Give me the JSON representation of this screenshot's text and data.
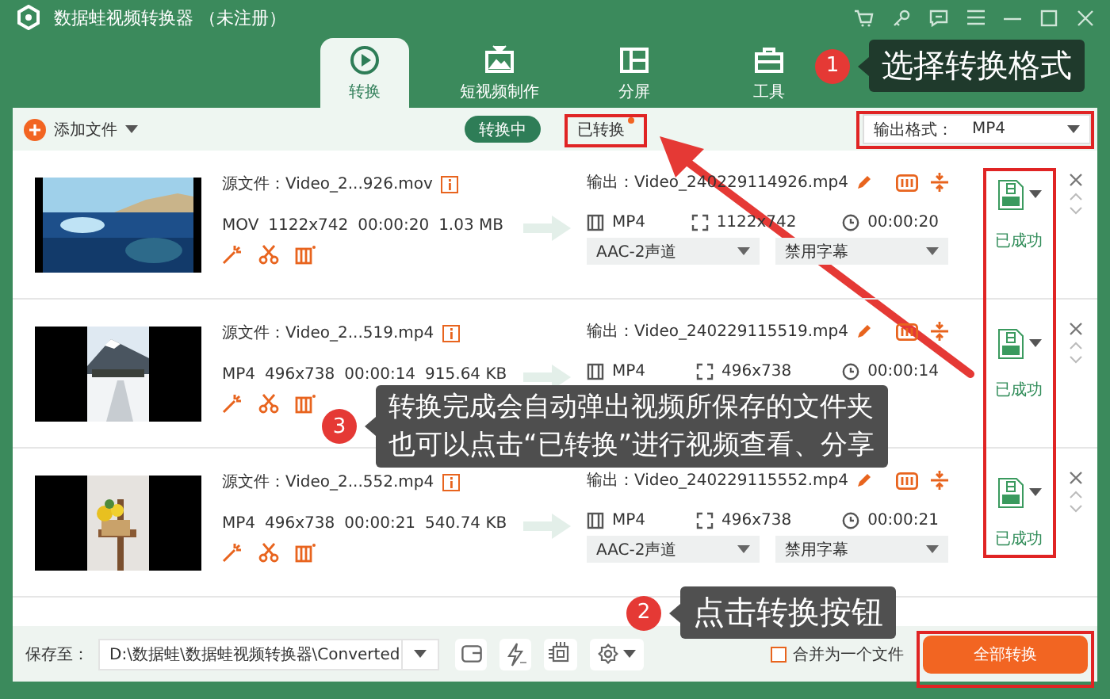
{
  "window": {
    "title": "数据蛙视频转换器 （未注册）"
  },
  "tabs": [
    {
      "label": "转换",
      "selected": true
    },
    {
      "label": "短视频制作",
      "selected": false
    },
    {
      "label": "分屏",
      "selected": false
    },
    {
      "label": "工具",
      "selected": false
    }
  ],
  "toolbar": {
    "add_file": "添加文件",
    "views": [
      {
        "label": "转换中",
        "selected": true,
        "badge_dot": false
      },
      {
        "label": "已转换",
        "selected": false,
        "badge_dot": true
      }
    ],
    "output_format": {
      "label": "输出格式：",
      "value": "MP4"
    }
  },
  "files": [
    {
      "source": "源文件：Video_2...926.mov",
      "format": "MOV",
      "resolution": "1122x742",
      "duration": "00:00:20",
      "size": "1.03 MB",
      "output": "输出：Video_240229114926.mp4",
      "out_format": "MP4",
      "out_resolution": "1122x742",
      "out_duration": "00:00:20",
      "audio": "AAC-2声道",
      "subtitle": "禁用字幕",
      "status": "已成功"
    },
    {
      "source": "源文件：Video_2...519.mp4",
      "format": "MP4",
      "resolution": "496x738",
      "duration": "00:00:14",
      "size": "915.64 KB",
      "output": "输出：Video_240229115519.mp4",
      "out_format": "MP4",
      "out_resolution": "496x738",
      "out_duration": "00:00:14",
      "status": "已成功"
    },
    {
      "source": "源文件：Video_2...552.mp4",
      "format": "MP4",
      "resolution": "496x738",
      "duration": "00:00:21",
      "size": "540.74 KB",
      "output": "输出：Video_240229115552.mp4",
      "out_format": "MP4",
      "out_resolution": "496x738",
      "out_duration": "00:00:21",
      "audio": "AAC-2声道",
      "subtitle": "禁用字幕",
      "status": "已成功"
    }
  ],
  "bottom_bar": {
    "save_label": "保存至：",
    "path": "D:\\数据蛙\\数据蛙视频转换器\\Converted",
    "merge": {
      "label": "合并为一个文件",
      "checked": false
    },
    "convert_all": "全部转换"
  },
  "callouts": [
    {
      "number": "1",
      "lines": [
        "选择转换格式"
      ]
    },
    {
      "number": "3",
      "lines": [
        "转换完成会自动弹出视频所保存的文件夹",
        "也可以点击“已转换”进行视频查看、分享"
      ]
    },
    {
      "number": "2",
      "lines": [
        "点击转换按钮"
      ]
    }
  ]
}
